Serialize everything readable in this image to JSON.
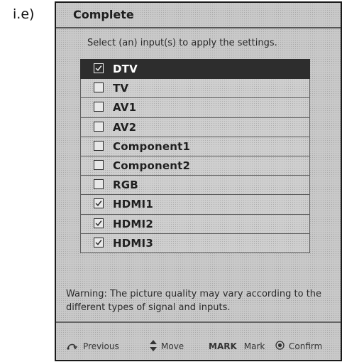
{
  "step_label": "i.e)",
  "dialog": {
    "title": "Complete",
    "instruction": "Select (an) input(s) to apply the settings.",
    "items": [
      {
        "label": "DTV",
        "checked": true,
        "selected": true
      },
      {
        "label": "TV",
        "checked": false,
        "selected": false
      },
      {
        "label": "AV1",
        "checked": false,
        "selected": false
      },
      {
        "label": "AV2",
        "checked": false,
        "selected": false
      },
      {
        "label": "Component1",
        "checked": false,
        "selected": false
      },
      {
        "label": "Component2",
        "checked": false,
        "selected": false
      },
      {
        "label": "RGB",
        "checked": false,
        "selected": false
      },
      {
        "label": "HDMI1",
        "checked": true,
        "selected": false
      },
      {
        "label": "HDMI2",
        "checked": true,
        "selected": false
      },
      {
        "label": "HDMI3",
        "checked": true,
        "selected": false
      }
    ],
    "warning": "Warning: The picture quality may vary according to the different types of signal and inputs."
  },
  "footer": {
    "previous": {
      "label": "Previous",
      "icon": "return-arrow-icon"
    },
    "move": {
      "label": "Move",
      "icon": "up-down-arrow-icon"
    },
    "mark": {
      "key": "MARK",
      "label": "Mark"
    },
    "confirm": {
      "label": "Confirm",
      "icon": "ok-circle-icon"
    }
  }
}
